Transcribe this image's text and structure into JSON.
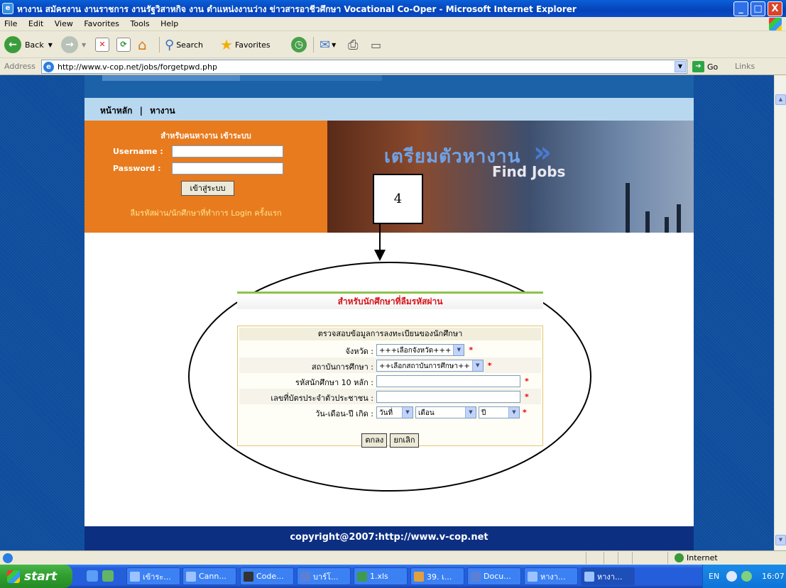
{
  "window": {
    "title": "หางาน สมัครงาน งานราชการ งานรัฐวิสาหกิจ งาน ตำแหน่งงานว่าง ข่าวสารอาชีวศึกษา Vocational Co-Oper - Microsoft Internet Explorer",
    "minimize": "_",
    "maximize": "□",
    "close": "X"
  },
  "menu": [
    "File",
    "Edit",
    "View",
    "Favorites",
    "Tools",
    "Help"
  ],
  "toolbar": {
    "back": "Back",
    "search": "Search",
    "favorites": "Favorites"
  },
  "address": {
    "label": "Address",
    "url": "http://www.v-cop.net/jobs/forgetpwd.php",
    "go": "Go",
    "links": "Links"
  },
  "page": {
    "nav": [
      "หน้าหลัก",
      "|",
      "หางาน"
    ],
    "login": {
      "heading": "สำหรับคนหางาน เข้าระบบ",
      "username_label": "Username :",
      "password_label": "Password :",
      "submit": "เข้าสู่ระบบ",
      "forgot_link": "ลืมรหัสผ่าน/นักศึกษาที่ทำการ Login ครั้งแรก"
    },
    "banner": {
      "thai_text": "เตรียมตัวหางาน",
      "english_text": "Find Jobs"
    },
    "annotation_number": "4",
    "form": {
      "title": "สำหรับนักศึกษาที่ลืมรหัสผ่าน",
      "header": "ตรวจสอบข้อมูลการลงทะเบียนของนักศึกษา",
      "province_label": "จังหวัด :",
      "province_value": "+++เลือกจังหวัด+++",
      "institution_label": "สถาบันการศึกษา :",
      "institution_value": "++เลือกสถาบันการศึกษา++",
      "student_id_label": "รหัสนักศึกษา 10 หลัก :",
      "citizen_id_label": "เลขที่บัตรประจำตัวประชาชน :",
      "dob_label": "วัน-เดือน-ปี เกิด :",
      "dob_day": "วันที่",
      "dob_month": "เดือน",
      "dob_year": "ปี",
      "required_mark": "*",
      "ok_button": "ตกลง",
      "cancel_button": "ยกเลิก"
    },
    "footer": "copyright@2007:http://www.v-cop.net"
  },
  "statusbar": {
    "zone": "Internet"
  },
  "taskbar": {
    "start": "start",
    "tasks": [
      "เข้าระ...",
      "Cann...",
      "Code...",
      "บาร์โ...",
      "1.xls",
      "39. เ...",
      "Docu...",
      "หางา...",
      "หางา..."
    ],
    "lang": "EN",
    "clock": "16:07"
  }
}
